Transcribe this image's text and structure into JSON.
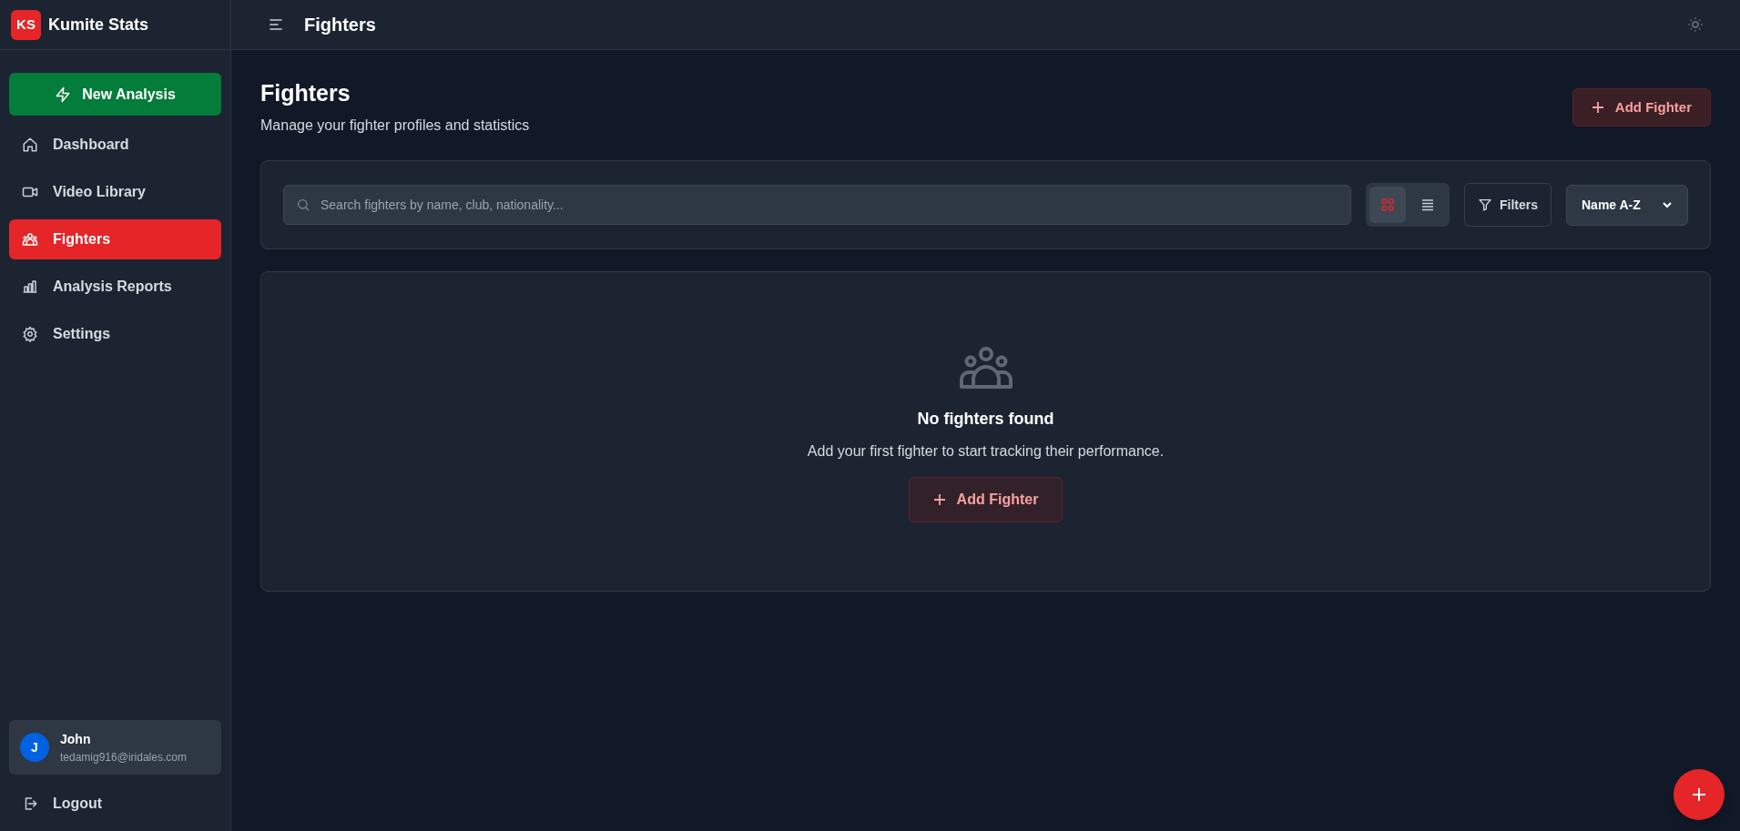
{
  "brand": {
    "logo": "KS",
    "name": "Kumite Stats"
  },
  "header": {
    "title": "Fighters"
  },
  "sidebar": {
    "action": "New Analysis",
    "items": [
      {
        "label": "Dashboard",
        "kind": "home",
        "selected": false
      },
      {
        "label": "Video Library",
        "kind": "video",
        "selected": false
      },
      {
        "label": "Fighters",
        "kind": "users",
        "selected": true
      },
      {
        "label": "Analysis Reports",
        "kind": "chart",
        "selected": false
      },
      {
        "label": "Settings",
        "kind": "gear",
        "selected": false
      }
    ],
    "user": {
      "initial": "J",
      "name": "John",
      "email": "tedamig916@iridales.com"
    },
    "logout": "Logout"
  },
  "page": {
    "title": "Fighters",
    "subtitle": "Manage your fighter profiles and statistics",
    "add_button": "Add Fighter"
  },
  "toolbar": {
    "search_placeholder": "Search fighters by name, club, nationality...",
    "views": [
      {
        "kind": "grid",
        "selected": true
      },
      {
        "kind": "list",
        "selected": false
      }
    ],
    "filters": "Filters",
    "sort": "Name A-Z"
  },
  "empty": {
    "title": "No fighters found",
    "text": "Add your first fighter to start tracking their performance.",
    "button": "Add Fighter"
  }
}
